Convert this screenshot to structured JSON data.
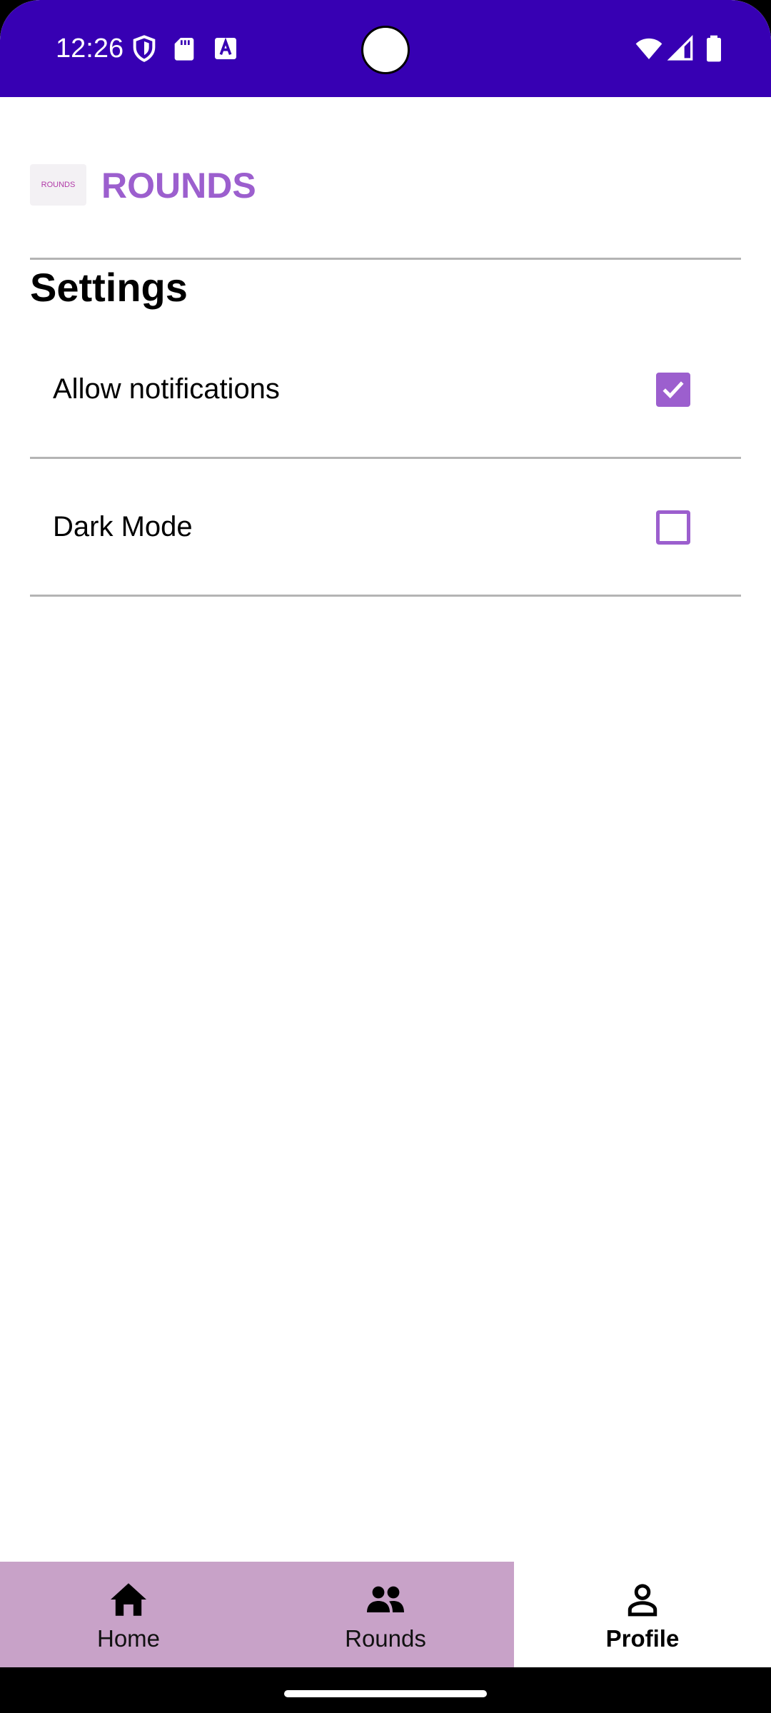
{
  "status_bar": {
    "time": "12:26",
    "background": "#3700b3",
    "left_icons": [
      "shield-icon",
      "sd-card-icon",
      "text-a-icon"
    ],
    "right_icons": [
      "wifi-icon",
      "signal-icon",
      "battery-icon"
    ]
  },
  "header": {
    "logo_text": "ROUNDS",
    "title": "ROUNDS",
    "accent_color": "#9c5fce"
  },
  "settings": {
    "title": "Settings",
    "items": [
      {
        "label": "Allow notifications",
        "checked": true
      },
      {
        "label": "Dark Mode",
        "checked": false
      }
    ]
  },
  "bottom_nav": {
    "background": "#c8a2c8",
    "items": [
      {
        "label": "Home",
        "icon": "home-icon",
        "active": false
      },
      {
        "label": "Rounds",
        "icon": "group-icon",
        "active": false
      },
      {
        "label": "Profile",
        "icon": "person-icon",
        "active": true
      }
    ]
  }
}
